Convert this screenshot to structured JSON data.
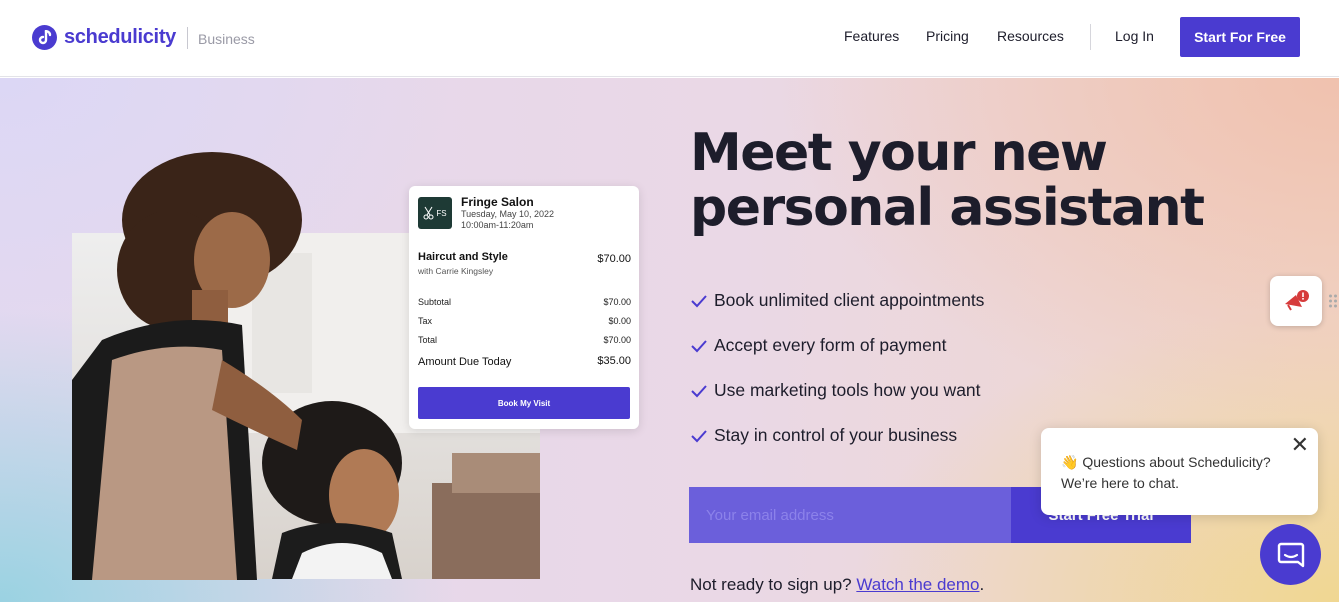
{
  "header": {
    "brand": "schedulicity",
    "brand_sub": "Business",
    "nav": [
      "Features",
      "Pricing",
      "Resources"
    ],
    "login": "Log In",
    "cta": "Start For Free"
  },
  "hero": {
    "headline_line1": "Meet your new",
    "headline_line2": "personal assistant",
    "bullets": [
      "Book unlimited client appointments",
      "Accept every form of payment",
      "Use marketing tools how you want",
      "Stay in control of your business"
    ],
    "email_placeholder": "Your email address",
    "trial_button": "Start Free Trial",
    "not_ready": "Not ready to sign up?",
    "watch_demo": "Watch the demo",
    "period": "."
  },
  "receipt": {
    "badge": "FS",
    "salon": "Fringe Salon",
    "date": "Tuesday, May 10, 2022",
    "time": "10:00am-11:20am",
    "service": "Haircut and Style",
    "with": "with Carrie Kingsley",
    "service_price": "$70.00",
    "lines": [
      {
        "label": "Subtotal",
        "value": "$70.00"
      },
      {
        "label": "Tax",
        "value": "$0.00"
      },
      {
        "label": "Total",
        "value": "$70.00"
      }
    ],
    "due_label": "Amount Due Today",
    "due_value": "$35.00",
    "book_button": "Book My Visit"
  },
  "chat": {
    "emoji": "👋",
    "line1": "Questions about Schedulicity?",
    "line2": "We’re here to chat.",
    "close": "✕"
  },
  "colors": {
    "brand": "#4a3bd0",
    "text": "#1d1d2b"
  }
}
